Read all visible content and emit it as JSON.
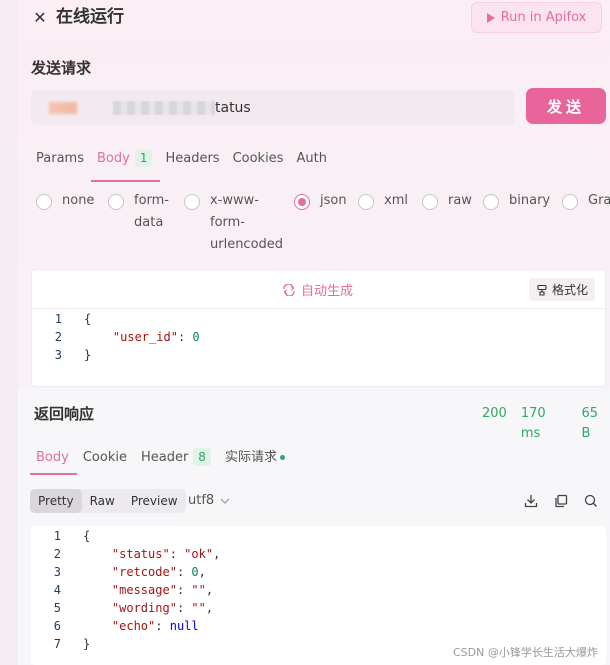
{
  "header": {
    "close_icon": "close-icon",
    "title": "在线运行",
    "run_button_label": "Run in Apifox"
  },
  "request": {
    "section_title": "发送请求",
    "url_suffix": "tatus",
    "send_label": "发送",
    "tabs": [
      {
        "label": "Params",
        "active": false
      },
      {
        "label": "Body",
        "badge": "1",
        "active": true
      },
      {
        "label": "Headers",
        "active": false
      },
      {
        "label": "Cookies",
        "active": false
      },
      {
        "label": "Auth",
        "active": false
      }
    ],
    "body_types": [
      {
        "label": "none",
        "checked": false
      },
      {
        "label": "form-data",
        "checked": false
      },
      {
        "label": "x-www-form-urlencoded",
        "checked": false
      },
      {
        "label": "json",
        "checked": true
      },
      {
        "label": "xml",
        "checked": false
      },
      {
        "label": "raw",
        "checked": false
      },
      {
        "label": "binary",
        "checked": false
      },
      {
        "label": "Gra",
        "checked": false
      }
    ],
    "auto_generate_label": "自动生成",
    "format_label": "格式化",
    "body_lines": [
      {
        "n": "1",
        "t": "{"
      },
      {
        "n": "2",
        "k": "\"user_id\"",
        "v": "0",
        "vt": "num"
      },
      {
        "n": "3",
        "t": "}"
      }
    ]
  },
  "response": {
    "section_title": "返回响应",
    "status_code": "200",
    "time": "170 ms",
    "size": "65 B",
    "tabs": [
      {
        "label": "Body",
        "active": true
      },
      {
        "label": "Cookie",
        "active": false
      },
      {
        "label": "Header",
        "badge": "8",
        "active": false
      },
      {
        "label": "实际请求",
        "dot": true,
        "active": false
      }
    ],
    "view_modes": [
      "Pretty",
      "Raw",
      "Preview"
    ],
    "selected_view": "Pretty",
    "encoding": "utf8",
    "body_lines": [
      {
        "n": "1",
        "t": "{"
      },
      {
        "n": "2",
        "k": "\"status\"",
        "v": "\"ok\"",
        "vt": "str",
        "comma": true
      },
      {
        "n": "3",
        "k": "\"retcode\"",
        "v": "0",
        "vt": "num",
        "comma": true
      },
      {
        "n": "4",
        "k": "\"message\"",
        "v": "\"\"",
        "vt": "str",
        "comma": true
      },
      {
        "n": "5",
        "k": "\"wording\"",
        "v": "\"\"",
        "vt": "str",
        "comma": true
      },
      {
        "n": "6",
        "k": "\"echo\"",
        "v": "null",
        "vt": "kw"
      },
      {
        "n": "7",
        "t": "}"
      }
    ]
  },
  "watermark": "CSDN @小锋学长生活大爆炸",
  "colors": {
    "accent": "#e8659b",
    "success": "#2fa865"
  }
}
